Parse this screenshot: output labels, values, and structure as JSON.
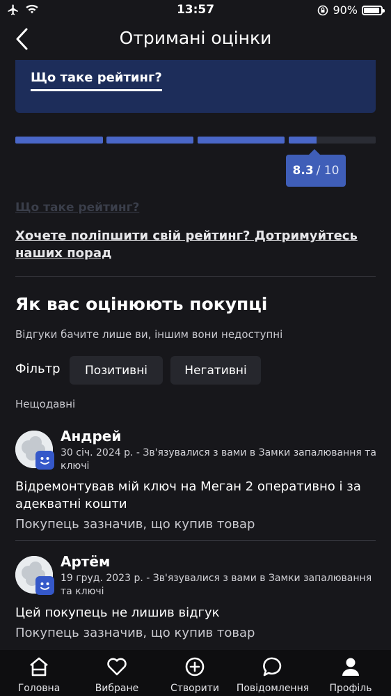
{
  "status_bar": {
    "time": "13:57",
    "battery": "90%",
    "battery_level": 0.9
  },
  "header": {
    "title": "Отримані оцінки"
  },
  "info_card": {
    "link": "Що таке рейтинг?"
  },
  "rating": {
    "score": "8.3",
    "out_of": "/ 10",
    "value": 8.3,
    "max": 10
  },
  "links": {
    "what_is_rating": "Що таке рейтинг?",
    "improve": "Хочете поліпшити свій рейтинг? Дотримуйтесь наших порад"
  },
  "buyers": {
    "title": "Як вас оцінюють покупці",
    "subtitle": "Відгуки бачите лише ви, іншим вони недоступні",
    "filter_label": "Фільтр",
    "filters": [
      "Позитивні",
      "Негативні"
    ],
    "group_label": "Нещодавні"
  },
  "reviews": [
    {
      "name": "Андрей",
      "meta": "30 січ. 2024 р. - Зв'язувалися з вами в Замки запалювання та ключі",
      "text": "Відремонтував мій ключ на Меган 2 оперативно і за адекватні кошти",
      "note": "Покупець зазначив, що купив товар"
    },
    {
      "name": "Артём",
      "meta": "19 груд. 2023 р. - Зв'язувалися з вами в Замки запалювання та ключі",
      "text": "Цей покупець не лишив відгук",
      "note": "Покупець зазначив, що купив товар"
    }
  ],
  "nav": [
    {
      "label": "Головна",
      "icon": "home-icon"
    },
    {
      "label": "Вибране",
      "icon": "heart-icon"
    },
    {
      "label": "Створити",
      "icon": "plus-circle-icon"
    },
    {
      "label": "Повідомлення",
      "icon": "chat-icon"
    },
    {
      "label": "Профіль",
      "icon": "profile-icon"
    }
  ],
  "colors": {
    "background": "#17171b",
    "accent": "#4a67c8",
    "card": "#1d2d5a",
    "nav": "#0e0e10"
  }
}
